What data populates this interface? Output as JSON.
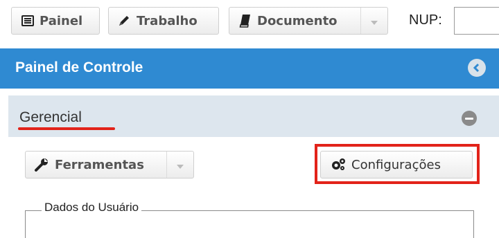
{
  "toolbar": {
    "painel_label": "Painel",
    "trabalho_label": "Trabalho",
    "documento_label": "Documento",
    "nup_label": "NUP:",
    "nup_value": ""
  },
  "panel": {
    "title": "Painel de Controle"
  },
  "section": {
    "title": "Gerencial"
  },
  "content": {
    "ferramentas_label": "Ferramentas",
    "configuracoes_label": "Configurações",
    "fieldset_legend": "Dados do Usuário"
  },
  "colors": {
    "header_bg": "#2f8ad2",
    "section_bg": "#dde6ee",
    "highlight_red": "#e2231a"
  },
  "icons": {
    "painel": "list-icon",
    "trabalho": "pencil-icon",
    "documento": "book-icon",
    "ferramentas": "wrench-icon",
    "configuracoes": "gears-icon",
    "panel_collapse": "chevron-left-circle-icon",
    "section_collapse": "minus-circle-icon"
  }
}
